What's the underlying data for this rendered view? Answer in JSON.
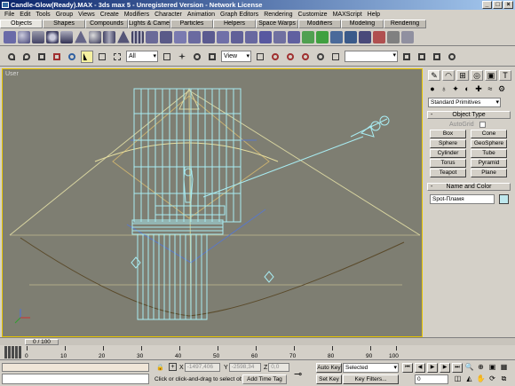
{
  "window": {
    "title": "Candle-Glow(Ready).MAX - 3ds max 5 - Unregistered Version - Network License",
    "controls": [
      "_",
      "□",
      "×"
    ]
  },
  "menu": [
    "File",
    "Edit",
    "Tools",
    "Group",
    "Views",
    "Create",
    "Modifiers",
    "Character",
    "Animation",
    "Graph Editors",
    "Rendering",
    "Customize",
    "MAXScript",
    "Help"
  ],
  "tabs": [
    "Objects",
    "Shapes",
    "Compounds",
    "Lights & Cameras",
    "Particles",
    "Helpers",
    "Space Warps",
    "Modifiers",
    "Modeling",
    "Rendering"
  ],
  "toolbar": {
    "selection_filter": "All",
    "reference_coord": "View"
  },
  "viewport": {
    "label": "User"
  },
  "command_panel": {
    "category": "Standard Primitives",
    "object_type_title": "Object Type",
    "autogrid_label": "AutoGrid",
    "buttons": [
      "Box",
      "Cone",
      "Sphere",
      "GeoSphere",
      "Cylinder",
      "Tube",
      "Torus",
      "Pyramid",
      "Teapot",
      "Plane"
    ],
    "name_color_title": "Name and Color",
    "object_name": "Spot-Пламя",
    "object_color": "#bfe8ee"
  },
  "timeline": {
    "slider_label": "0 / 100",
    "ruler_labels": [
      "0",
      "10",
      "20",
      "30",
      "40",
      "50",
      "60",
      "70",
      "80",
      "90",
      "100"
    ]
  },
  "status": {
    "x_label": "X",
    "x_value": "-1497,406",
    "y_label": "Y",
    "y_value": "-2598,34",
    "z_label": "Z",
    "z_value": "0,0",
    "prompt": "Click or click-and-drag to select obj",
    "add_time_tag": "Add Time Tag",
    "auto_key": "Auto Key",
    "set_key": "Set Key",
    "key_mode": "Selected",
    "key_filters": "Key Filters...",
    "current_frame": "0"
  },
  "colors": {
    "viewport_bg": "#7e7e72",
    "active_border": "#e8c400",
    "wireframe": "#a8ecf2",
    "spotlight_cone": "#d8d4a0",
    "titlebar": "#0a246a"
  }
}
